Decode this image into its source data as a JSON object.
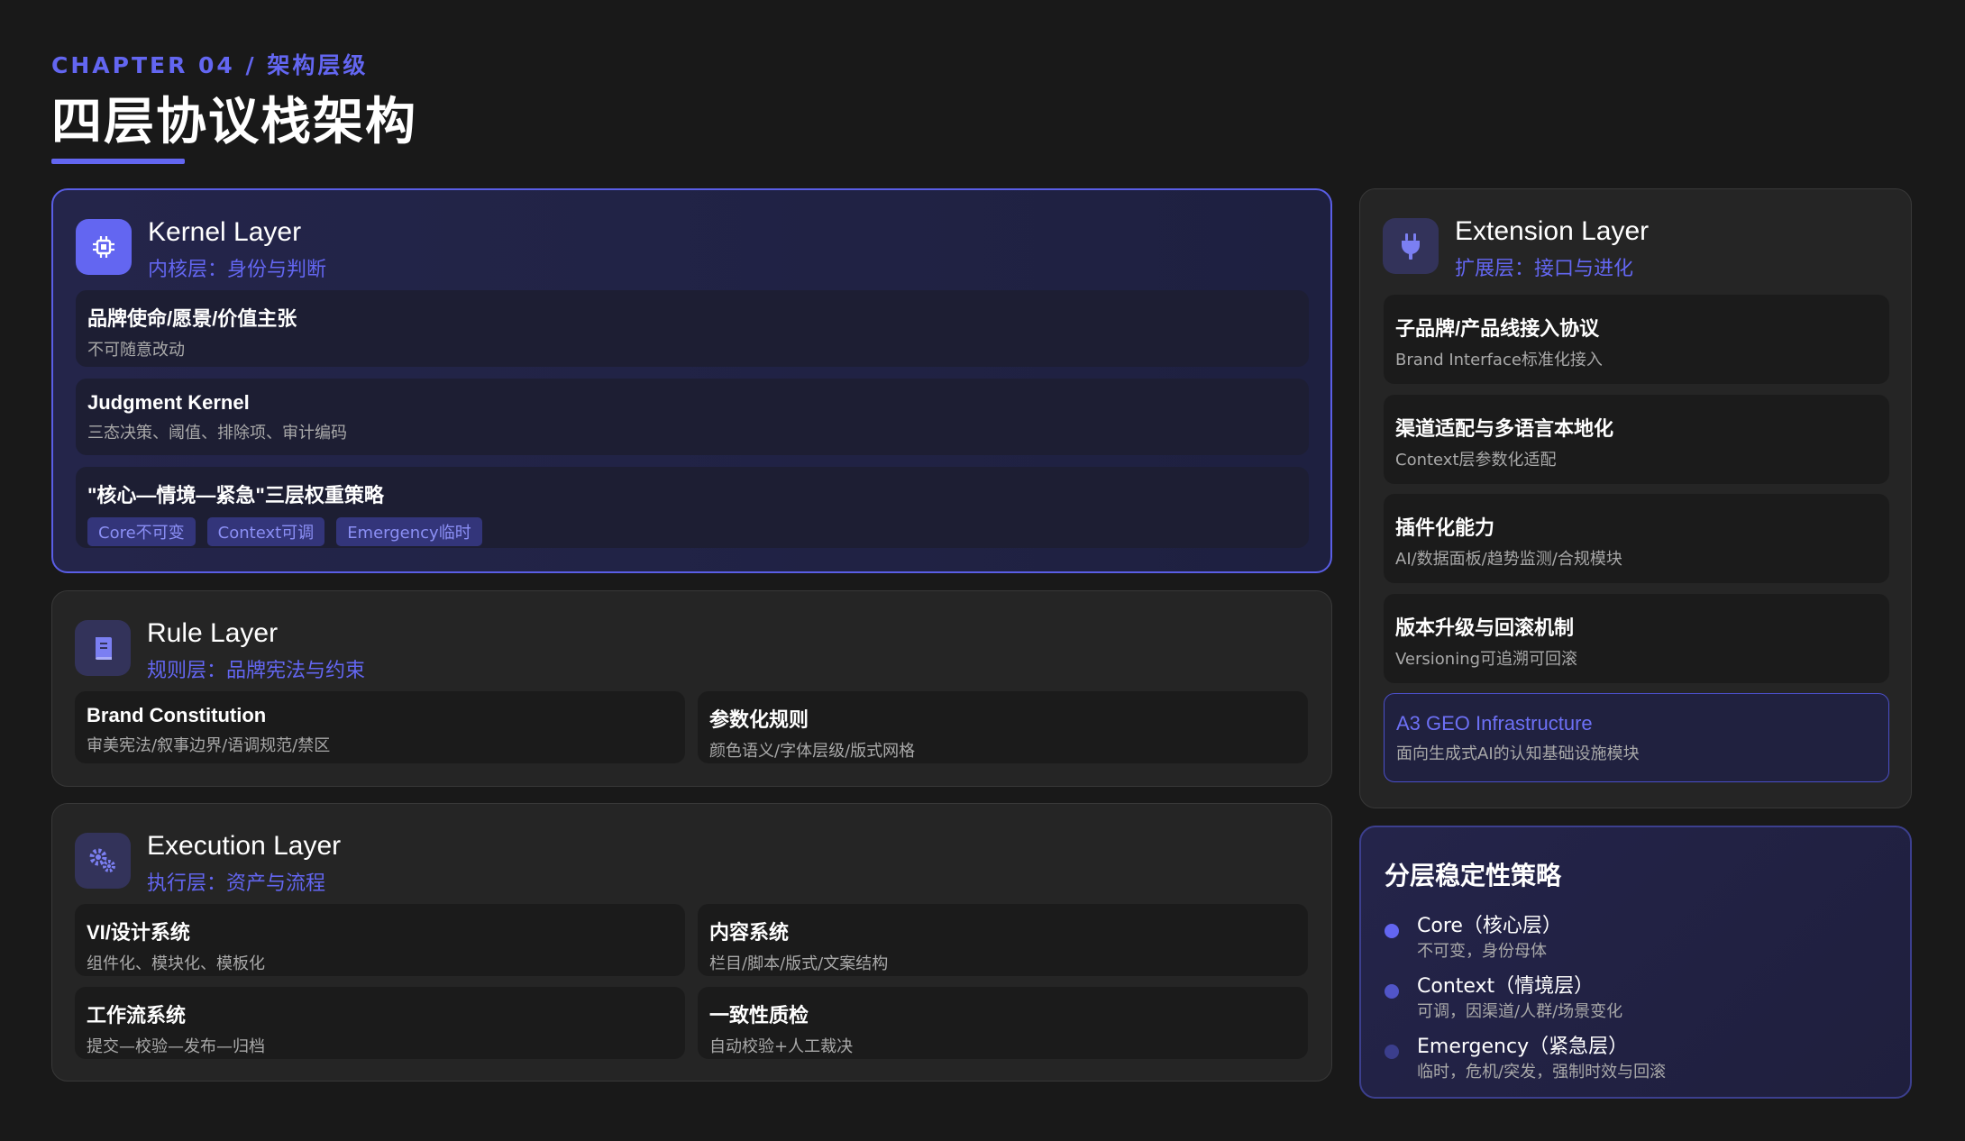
{
  "header": {
    "chapter": "CHAPTER 04 / 架构层级",
    "title": "四层协议栈架构"
  },
  "colors": {
    "accent": "#6366f1",
    "background": "#191919",
    "card": "#252525"
  },
  "kernel": {
    "icon": "chip-icon",
    "name": "Kernel Layer",
    "subtitle": "内核层：身份与判断",
    "items": [
      {
        "title": "品牌使命/愿景/价值主张",
        "desc": "不可随意改动"
      },
      {
        "title": "Judgment Kernel",
        "desc": "三态决策、阈值、排除项、审计编码"
      },
      {
        "title": "\"核心—情境—紧急\"三层权重策略",
        "tags": [
          "Core不可变",
          "Context可调",
          "Emergency临时"
        ]
      }
    ]
  },
  "rule": {
    "icon": "book-icon",
    "name": "Rule Layer",
    "subtitle": "规则层：品牌宪法与约束",
    "items": [
      {
        "title": "Brand Constitution",
        "desc": "审美宪法/叙事边界/语调规范/禁区"
      },
      {
        "title": "参数化规则",
        "desc": "颜色语义/字体层级/版式网格"
      }
    ]
  },
  "execution": {
    "icon": "gears-icon",
    "name": "Execution Layer",
    "subtitle": "执行层：资产与流程",
    "items": [
      {
        "title": "VI/设计系统",
        "desc": "组件化、模块化、模板化"
      },
      {
        "title": "内容系统",
        "desc": "栏目/脚本/版式/文案结构"
      },
      {
        "title": "工作流系统",
        "desc": "提交—校验—发布—归档"
      },
      {
        "title": "一致性质检",
        "desc": "自动校验+人工裁决"
      }
    ]
  },
  "extension": {
    "icon": "plug-icon",
    "name": "Extension Layer",
    "subtitle": "扩展层：接口与进化",
    "items": [
      {
        "title": "子品牌/产品线接入协议",
        "desc": "Brand Interface标准化接入"
      },
      {
        "title": "渠道适配与多语言本地化",
        "desc": "Context层参数化适配"
      },
      {
        "title": "插件化能力",
        "desc": "AI/数据面板/趋势监测/合规模块"
      },
      {
        "title": "版本升级与回滚机制",
        "desc": "Versioning可追溯可回滚"
      },
      {
        "title": "A3 GEO Infrastructure",
        "desc": "面向生成式AI的认知基础设施模块"
      }
    ]
  },
  "strategy": {
    "title": "分层稳定性策略",
    "levels": [
      {
        "name": "Core（核心层）",
        "desc": "不可变，身份母体",
        "color": "#6366f1"
      },
      {
        "name": "Context（情境层）",
        "desc": "可调，因渠道/人群/场景变化",
        "color": "#5155c8"
      },
      {
        "name": "Emergency（紧急层）",
        "desc": "临时，危机/突发，强制时效与回滚",
        "color": "#3b3e8c"
      }
    ]
  }
}
